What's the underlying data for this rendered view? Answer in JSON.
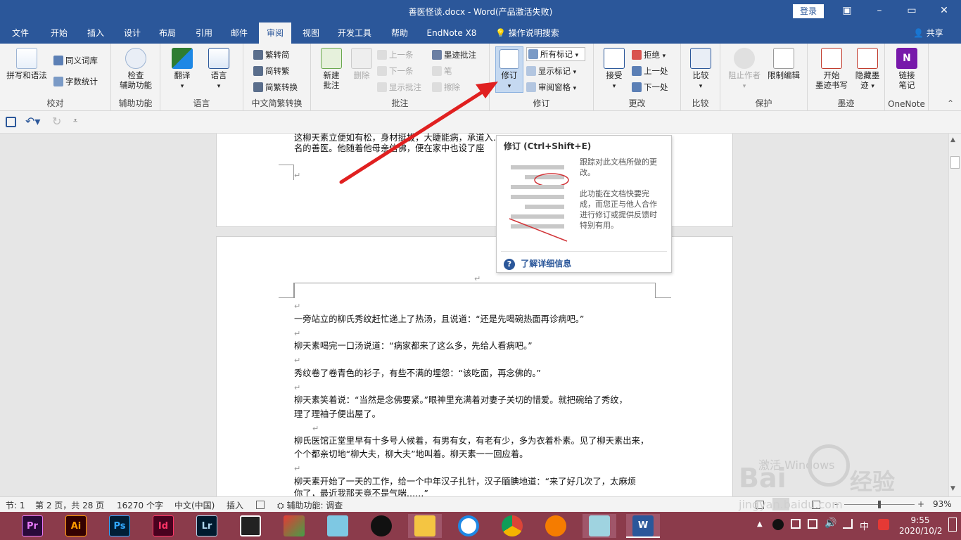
{
  "window": {
    "title": "善医怪谈.docx  -  Word(产品激活失败)",
    "login_label": "登录",
    "min": "–",
    "restore": "▭",
    "close": "✕",
    "ribbon_opts": "▣"
  },
  "tabs": [
    {
      "label": "文件",
      "active": false
    },
    {
      "label": "开始",
      "active": false
    },
    {
      "label": "插入",
      "active": false
    },
    {
      "label": "设计",
      "active": false
    },
    {
      "label": "布局",
      "active": false
    },
    {
      "label": "引用",
      "active": false
    },
    {
      "label": "邮件",
      "active": false
    },
    {
      "label": "审阅",
      "active": true
    },
    {
      "label": "视图",
      "active": false
    },
    {
      "label": "开发工具",
      "active": false
    },
    {
      "label": "帮助",
      "active": false
    },
    {
      "label": "EndNote X8",
      "active": false
    }
  ],
  "tell_me": "操作说明搜索",
  "share": "共享",
  "ribbon": {
    "proofing": {
      "label": "校对",
      "spelling": "拼写和语法",
      "thesaurus": "同义词库",
      "wordcount": "字数统计"
    },
    "accessibility": {
      "label": "辅助功能",
      "check_l1": "检查",
      "check_l2": "辅助功能"
    },
    "language": {
      "label": "语言",
      "translate": "翻译",
      "language": "语言"
    },
    "chinese": {
      "label": "中文简繁转换",
      "to_simp": "繁转简",
      "to_trad": "简转繁",
      "convert": "简繁转换"
    },
    "comments": {
      "label": "批注",
      "new_l1": "新建",
      "new_l2": "批注",
      "delete": "删除",
      "prev": "上一条",
      "next": "下一条",
      "show": "显示批注",
      "ink_comment": "墨迹批注",
      "pen": "笔",
      "erase": "擦除"
    },
    "tracking": {
      "label": "修订",
      "track": "修订",
      "markup": "所有标记",
      "show_markup": "显示标记",
      "pane": "审阅窗格"
    },
    "changes": {
      "label": "更改",
      "accept": "接受",
      "reject": "拒绝",
      "prev": "上一处",
      "next": "下一处"
    },
    "compare": {
      "label": "比较",
      "compare": "比较"
    },
    "protect": {
      "label": "保护",
      "block": "阻止作者",
      "restrict": "限制编辑"
    },
    "ink": {
      "label": "墨迹",
      "start_l1": "开始",
      "start_l2": "墨迹书写",
      "hide_l1": "隐藏墨",
      "hide_l2": "迹"
    },
    "onenote": {
      "label": "OneNote",
      "link_l1": "链接",
      "link_l2": "笔记"
    }
  },
  "tooltip": {
    "title": "修订 (Ctrl+Shift+E)",
    "desc1_l1": "跟踪对此文档所做的更",
    "desc1_l2": "改。",
    "desc2_l1": "此功能在文档快要完",
    "desc2_l2": "成，而您正与他人合作",
    "desc2_l3": "进行修订或提供反馈时",
    "desc2_l4": "特别有用。",
    "link": "了解详细信息"
  },
  "document": {
    "page1_line1": "这柳天素立便如有松，身材挺拔，大睫能病，承道入……",
    "page1_line2": "名的善医。他随着他母亲信佛，便在家中也设了座",
    "paragraphs": [
      "一旁站立的柳氏秀纹赶忙递上了热汤，且说道：“还是先喝碗热面再诊病吧。”",
      "柳天素喝完一口汤说道：“病家都来了这么多，先给人看病吧。”",
      "秀纹卷了卷青色的衫子，有些不满的埋怨：“该吃面，再念佛的。”",
      "柳天素笑着说：“当然是念佛要紧。”眼神里充满着对妻子关切的惜爱。就把碗给了秀纹，",
      "理了理袖子便出屋了。",
      "柳氏医馆正堂里早有十多号人候着，有男有女，有老有少，多为衣着朴素。见了柳天素出来，",
      "个个都亲切地“柳大夫，柳大夫”地叫着。柳天素一一回应着。",
      "柳天素开始了一天的工作，给一个中年汉子扎针，汉子腼腆地道：“来了好几次了，太麻烦",
      "你了，最近我那天竟不是气喘……”"
    ],
    "para_mark": "↵"
  },
  "status": {
    "section": "节: 1",
    "page": "第 2 页，共 28 页",
    "words": "16270 个字",
    "lang": "中文(中国)",
    "mode": "插入",
    "accessibility": "辅助功能: 调查",
    "zoom": "93%",
    "zoom_minus": "–",
    "zoom_plus": "+"
  },
  "watermark": {
    "activate": "激活 Windows",
    "baidu_en": "Bai",
    "baidu_cn": "经验",
    "url": "jingyan.baidu.com"
  },
  "taskbar": {
    "apps": [
      "Pr",
      "Ai",
      "Ps",
      "Id",
      "Lr"
    ],
    "time": "9:55",
    "date": "2020/10/2",
    "ime": "中"
  },
  "colors": {
    "accent": "#2b579a",
    "taskbar": "#8b3b4b",
    "arrow": "#e02020"
  }
}
